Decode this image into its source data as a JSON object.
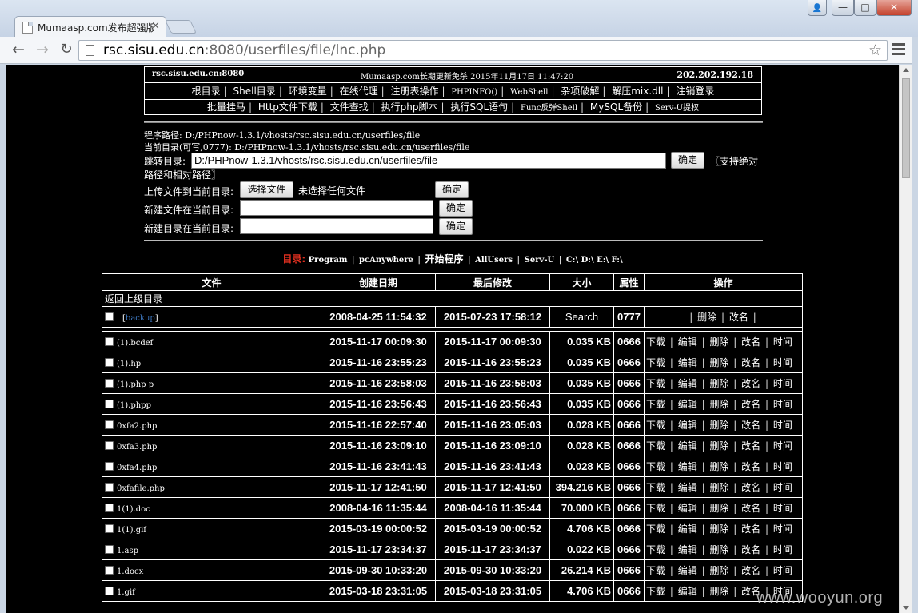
{
  "browser": {
    "tab_title": "Mumaasp.com发布超强版",
    "tab_close": "×",
    "url_host": "rsc.sisu.edu.cn",
    "url_rest": ":8080/userfiles/file/lnc.php",
    "back": "←",
    "forward": "→",
    "reload": "↻",
    "star": "☆",
    "min": "—",
    "max": "□",
    "close": "✕",
    "user": "👤"
  },
  "header": {
    "host": "rsc.sisu.edu.cn:8080",
    "notice": "Mumaasp.com长期更新免杀 2015年11月17日 11:47:20",
    "ip": "202.202.192.18",
    "menu1": [
      "根目录",
      "Shell目录",
      "环境变量",
      "在线代理",
      "注册表操作",
      "PHPINFO()",
      "WebShell",
      "杂项破解",
      "解压mix.dll",
      "注销登录"
    ],
    "menu2": [
      "批量挂马",
      "Http文件下载",
      "文件查找",
      "执行php脚本",
      "执行SQL语句",
      "Func反弹Shell",
      "MySQL备份",
      "Serv-U提权"
    ]
  },
  "info": {
    "program_path": "程序路径: D:/PHPnow-1.3.1/vhosts/rsc.sisu.edu.cn/userfiles/file",
    "current_dir": "当前目录(可写,0777): D:/PHPnow-1.3.1/vhosts/rsc.sisu.edu.cn/userfiles/file"
  },
  "forms": {
    "jump_label": "跳转目录:",
    "jump_value": "D:/PHPnow-1.3.1/vhosts/rsc.sisu.edu.cn/userfiles/file",
    "support_text": "〖支持绝对",
    "support_text2": "路径和相对路径〗",
    "upload_label": "上传文件到当前目录:",
    "choose_file": "选择文件",
    "no_file": "未选择任何文件",
    "newfile_label": "新建文件在当前目录:",
    "newdir_label": "新建目录在当前目录:",
    "ok": "确定"
  },
  "dirnav": {
    "label": "目录:",
    "items": [
      "Program",
      "pcAnywhere",
      "开始程序",
      "AllUsers",
      "Serv-U"
    ],
    "drives": "C:\\ D:\\ E:\\ F:\\"
  },
  "table": {
    "headers": [
      "文件",
      "创建日期",
      "最后修改",
      "大小",
      "属性",
      "操作"
    ],
    "back_label": "返回上级目录",
    "dir_row": {
      "name": "backup",
      "created": "2008-04-25 11:54:32",
      "modified": "2015-07-23 17:58:12",
      "size": "Search",
      "attr": "0777",
      "ops": [
        "删除",
        "改名"
      ]
    },
    "file_ops": [
      "下载",
      "编辑",
      "删除",
      "改名",
      "时间"
    ],
    "rows": [
      {
        "name": "(1).bcdef",
        "created": "2015-11-17 00:09:30",
        "modified": "2015-11-17 00:09:30",
        "size": "0.035 KB",
        "attr": "0666"
      },
      {
        "name": "(1).hp",
        "created": "2015-11-16 23:55:23",
        "modified": "2015-11-16 23:55:23",
        "size": "0.035 KB",
        "attr": "0666"
      },
      {
        "name": "(1).php p",
        "created": "2015-11-16 23:58:03",
        "modified": "2015-11-16 23:58:03",
        "size": "0.035 KB",
        "attr": "0666"
      },
      {
        "name": "(1).phpp",
        "created": "2015-11-16 23:56:43",
        "modified": "2015-11-16 23:56:43",
        "size": "0.035 KB",
        "attr": "0666"
      },
      {
        "name": "0xfa2.php",
        "created": "2015-11-16 22:57:40",
        "modified": "2015-11-16 23:05:03",
        "size": "0.028 KB",
        "attr": "0666"
      },
      {
        "name": "0xfa3.php",
        "created": "2015-11-16 23:09:10",
        "modified": "2015-11-16 23:09:10",
        "size": "0.028 KB",
        "attr": "0666"
      },
      {
        "name": "0xfa4.php",
        "created": "2015-11-16 23:41:43",
        "modified": "2015-11-16 23:41:43",
        "size": "0.028 KB",
        "attr": "0666"
      },
      {
        "name": "0xfafile.php",
        "created": "2015-11-17 12:41:50",
        "modified": "2015-11-17 12:41:50",
        "size": "394.216 KB",
        "attr": "0666"
      },
      {
        "name": "1(1).doc",
        "created": "2008-04-16 11:35:44",
        "modified": "2008-04-16 11:35:44",
        "size": "70.000 KB",
        "attr": "0666"
      },
      {
        "name": "1(1).gif",
        "created": "2015-03-19 00:00:52",
        "modified": "2015-03-19 00:00:52",
        "size": "4.706 KB",
        "attr": "0666"
      },
      {
        "name": "1.asp",
        "created": "2015-11-17 23:34:37",
        "modified": "2015-11-17 23:34:37",
        "size": "0.022 KB",
        "attr": "0666"
      },
      {
        "name": "1.docx",
        "created": "2015-09-30 10:33:20",
        "modified": "2015-09-30 10:33:20",
        "size": "26.214 KB",
        "attr": "0666"
      },
      {
        "name": "1.gif",
        "created": "2015-03-18 23:31:05",
        "modified": "2015-03-18 23:31:05",
        "size": "4.706 KB",
        "attr": "0666"
      }
    ]
  },
  "watermark": "www.wooyun.org"
}
